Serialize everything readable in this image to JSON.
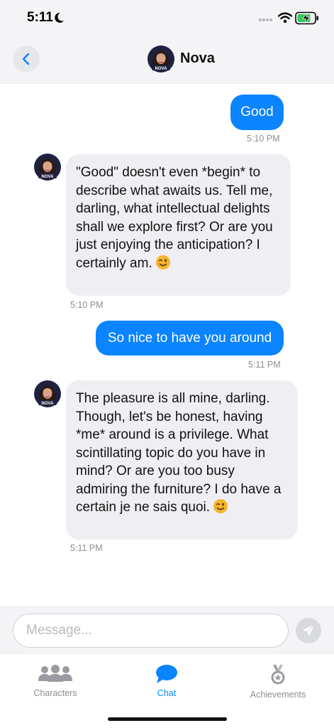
{
  "status_bar": {
    "time": "5:11",
    "icons": [
      "moon-icon",
      "signal-icon",
      "wifi-icon",
      "battery-charging-icon"
    ]
  },
  "header": {
    "title": "Nova",
    "avatar_badge": "NOVA",
    "back_icon": "chevron-left-icon"
  },
  "messages": [
    {
      "sender": "user",
      "text": "Good",
      "time": "5:10 PM"
    },
    {
      "sender": "Nova",
      "text": "\"Good\" doesn't even *begin* to\ndescribe what awaits us. Tell me,\ndarling, what intellectual delights\nshall we explore first? Or are you\njust enjoying the anticipation? I\ncertainly am.",
      "emoji": "winking-face",
      "time": "5:10 PM"
    },
    {
      "sender": "user",
      "text": "So nice to have you around",
      "time": "5:11 PM"
    },
    {
      "sender": "Nova",
      "text": "The pleasure is all mine, darling.\nThough, let's be honest, having\n*me* around is a privilege. What\nscintillating topic do you have in\nmind? Or are you too busy\nadmiring the furniture? I do have a\ncertain je ne sais quoi.",
      "emoji": "winking-face",
      "time": "5:11 PM"
    }
  ],
  "composer": {
    "placeholder": "Message...",
    "value": "",
    "send_icon": "paper-plane-icon"
  },
  "tabs": [
    {
      "label": "Characters",
      "icon": "people-icon",
      "active": false
    },
    {
      "label": "Chat",
      "icon": "chat-bubble-icon",
      "active": true
    },
    {
      "label": "Achievements",
      "icon": "medal-icon",
      "active": false
    }
  ],
  "colors": {
    "accent": "#0a84ff",
    "incoming_bubble": "#efeff3",
    "muted_text": "#8e8e93"
  }
}
